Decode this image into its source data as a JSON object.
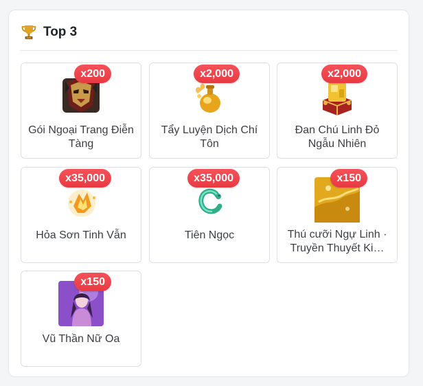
{
  "header": {
    "title": "Top 3",
    "icon": "trophy-icon"
  },
  "colors": {
    "badge": "#ef444c",
    "trophy_gold": "#d99a1e"
  },
  "items": [
    {
      "name": "Gói Ngoại Trang Điễn Tàng",
      "qty": "x200",
      "icon": "mask-icon"
    },
    {
      "name": "Tẩy Luyện Dịch Chí Tôn",
      "qty": "x2,000",
      "icon": "elixir-flask-icon"
    },
    {
      "name": "Đan Chú Linh Đỏ Ngẫu Nhiên",
      "qty": "x2,000",
      "icon": "gold-chest-icon"
    },
    {
      "name": "Hỏa Sơn Tinh Vẫn",
      "qty": "x35,000",
      "icon": "fire-crystal-icon"
    },
    {
      "name": "Tiên Ngọc",
      "qty": "x35,000",
      "icon": "jade-dragon-icon"
    },
    {
      "name": "Thú cưỡi Ngự Linh · Truyền Thuyết Ki…",
      "qty": "x150",
      "icon": "golden-mount-icon"
    },
    {
      "name": "Vũ Thần Nữ Oa",
      "qty": "x150",
      "icon": "goddess-portrait-icon"
    }
  ]
}
